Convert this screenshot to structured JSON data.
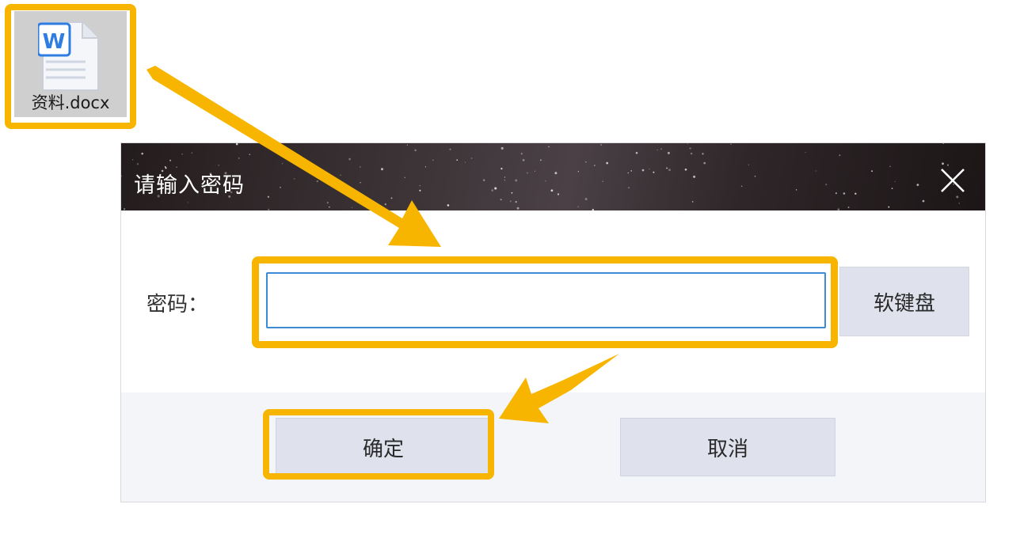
{
  "desktop": {
    "file": {
      "name": "资料.docx",
      "icon": "word-document-icon",
      "badge_letter": "W"
    }
  },
  "dialog": {
    "title": "请输入密码",
    "close_icon": "close-icon",
    "password_label": "密码：",
    "password_value": "",
    "soft_keyboard_label": "软键盘",
    "ok_label": "确定",
    "cancel_label": "取消"
  },
  "annotation": {
    "highlight_color": "#f7b500",
    "arrow_icon": "arrow-icon"
  },
  "colors": {
    "input_border": "#3d8ad6",
    "button_bg": "#dfe1ec",
    "footer_bg": "#f4f5f8",
    "word_blue": "#2f7de1"
  }
}
